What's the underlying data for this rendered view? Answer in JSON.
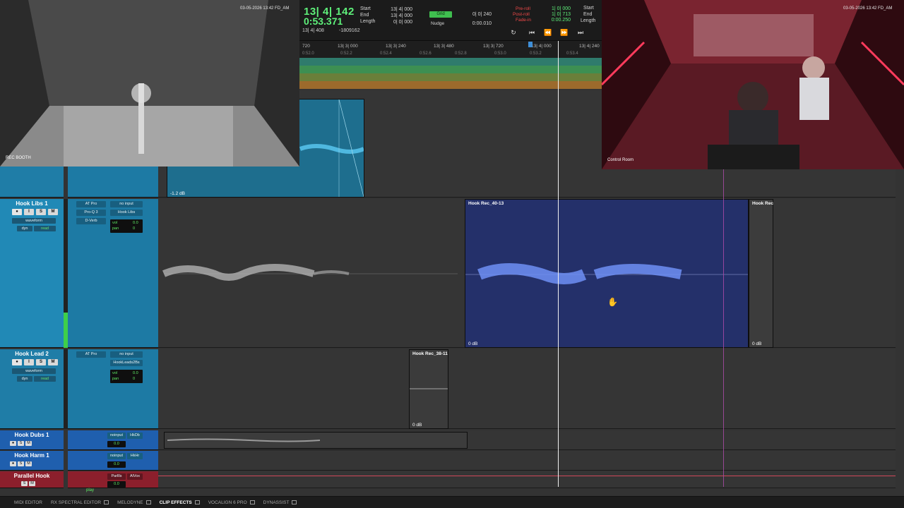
{
  "transport": {
    "counter_main": "13| 4| 142",
    "counter_sub": "0:53.371",
    "counter_small": "13| 4| 408",
    "pre_counter": "-1809162",
    "sel_labels": [
      "Start",
      "End",
      "Length"
    ],
    "sel_values": [
      "13| 4| 000",
      "13| 4| 000",
      "0| 0| 000"
    ],
    "grid_label": "Grid",
    "grid_value": "0| 0| 240",
    "nudge_label": "Nudge",
    "nudge_value": "0:00.010",
    "preroll_labels": [
      "Pre-roll",
      "Post-roll",
      "Fade-in"
    ],
    "preroll_values": [
      "1| 0| 000",
      "1| 0| 713",
      "0:00.250"
    ],
    "right_labels": [
      "Start",
      "End",
      "Length"
    ]
  },
  "ruler": {
    "bars": [
      "720",
      "13| 3| 000",
      "13| 3| 240",
      "13| 3| 480",
      "13| 3| 720",
      "13| 4| 000",
      "13| 4| 240"
    ],
    "times": [
      "0:52.0",
      "0:52.2",
      "0:52.4",
      "0:52.6",
      "0:52.8",
      "0:53.0",
      "0:53.2",
      "0:53.4"
    ]
  },
  "lanes": [
    "#2f7b6c",
    "#3d8f52",
    "#6a7f3a",
    "#9c6a2c"
  ],
  "cameras": {
    "booth_label": "REC BOOTH",
    "booth_time": "03-05-2026  13:42  FD_AM",
    "control_label": "Control Room",
    "control_time": "03-05-2026  13:42  FD_AM"
  },
  "tracks": [
    {
      "name": "Hook Libs 1",
      "inserts": [
        "AT Pro",
        "Pro-Q 3",
        "D-Verb"
      ],
      "io": [
        "no input",
        "Hook Libs"
      ],
      "view": "waveform",
      "dyn": "dyn",
      "auto": "read",
      "vol": "0.0",
      "pan": "0"
    },
    {
      "name": "Hook Lead 2",
      "inserts": [
        "AT Pro"
      ],
      "io": [
        "no input",
        "HookLeads2Bs"
      ],
      "view": "waveform",
      "dyn": "dyn",
      "auto": "read",
      "vol": "0.0",
      "pan": "0"
    }
  ],
  "compact_tracks": [
    {
      "name": "Hook Dubs 1",
      "input": "noinput",
      "out": "HkDb",
      "vol": "0.0"
    },
    {
      "name": "Hook Harm 1",
      "input": "noinput",
      "out": "HkHr",
      "vol": "0.0"
    },
    {
      "name": "Parallel Hook",
      "input": "Parllls",
      "out": "AlVox",
      "vol": "0.0",
      "status": "play"
    }
  ],
  "clips": {
    "top_gain": "-1.2 dB",
    "clip1_name": "Hook Rec_40-13",
    "clip1_gain": "0 dB",
    "clip2_name": "Hook Rec",
    "clip2_gain": "0 dB",
    "clip3_name": "Hook Rec_38-11",
    "clip3_gain": "0 dB"
  },
  "bottom_tabs": [
    "MIDI EDITOR",
    "RX SPECTRAL EDITOR",
    "MELODYNE",
    "CLIP EFFECTS",
    "VOCALIGN 6 PRO",
    "DYNASSIST"
  ],
  "active_tab": "CLIP EFFECTS"
}
